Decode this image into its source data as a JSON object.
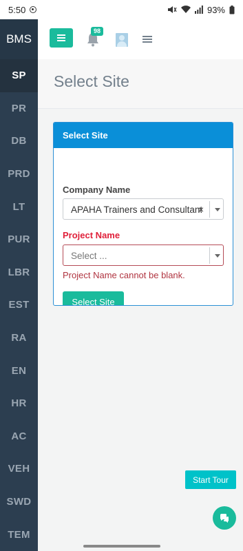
{
  "status_bar": {
    "time": "5:50",
    "battery": "93%"
  },
  "sidebar": {
    "brand": "BMS",
    "items": [
      {
        "label": "SP",
        "active": true
      },
      {
        "label": "PR",
        "active": false
      },
      {
        "label": "DB",
        "active": false
      },
      {
        "label": "PRD",
        "active": false
      },
      {
        "label": "LT",
        "active": false
      },
      {
        "label": "PUR",
        "active": false
      },
      {
        "label": "LBR",
        "active": false
      },
      {
        "label": "EST",
        "active": false
      },
      {
        "label": "RA",
        "active": false
      },
      {
        "label": "EN",
        "active": false
      },
      {
        "label": "HR",
        "active": false
      },
      {
        "label": "AC",
        "active": false
      },
      {
        "label": "VEH",
        "active": false
      },
      {
        "label": "SWD",
        "active": false
      },
      {
        "label": "TEM",
        "active": false
      }
    ]
  },
  "header": {
    "notification_count": "98"
  },
  "page": {
    "title": "Select Site"
  },
  "panel": {
    "title": "Select Site",
    "company_label": "Company Name",
    "company_value": "APAHA Trainers and Consultants",
    "clear_glyph": "×",
    "project_label": "Project Name",
    "project_placeholder": "Select ...",
    "project_error": "Project Name cannot be blank.",
    "submit_label": "Select Site"
  },
  "floating": {
    "tour_label": "Start Tour"
  },
  "colors": {
    "sidebar_bg": "#2c3e50",
    "accent_green": "#1abb9c",
    "panel_header": "#0a8fd8",
    "error_red": "#e0203a",
    "tour_button": "#00c2c9"
  },
  "icons": [
    "hamburger-icon",
    "bell-icon",
    "avatar-icon",
    "list-icon",
    "chat-icon",
    "clear-icon",
    "chevron-down-icon"
  ]
}
